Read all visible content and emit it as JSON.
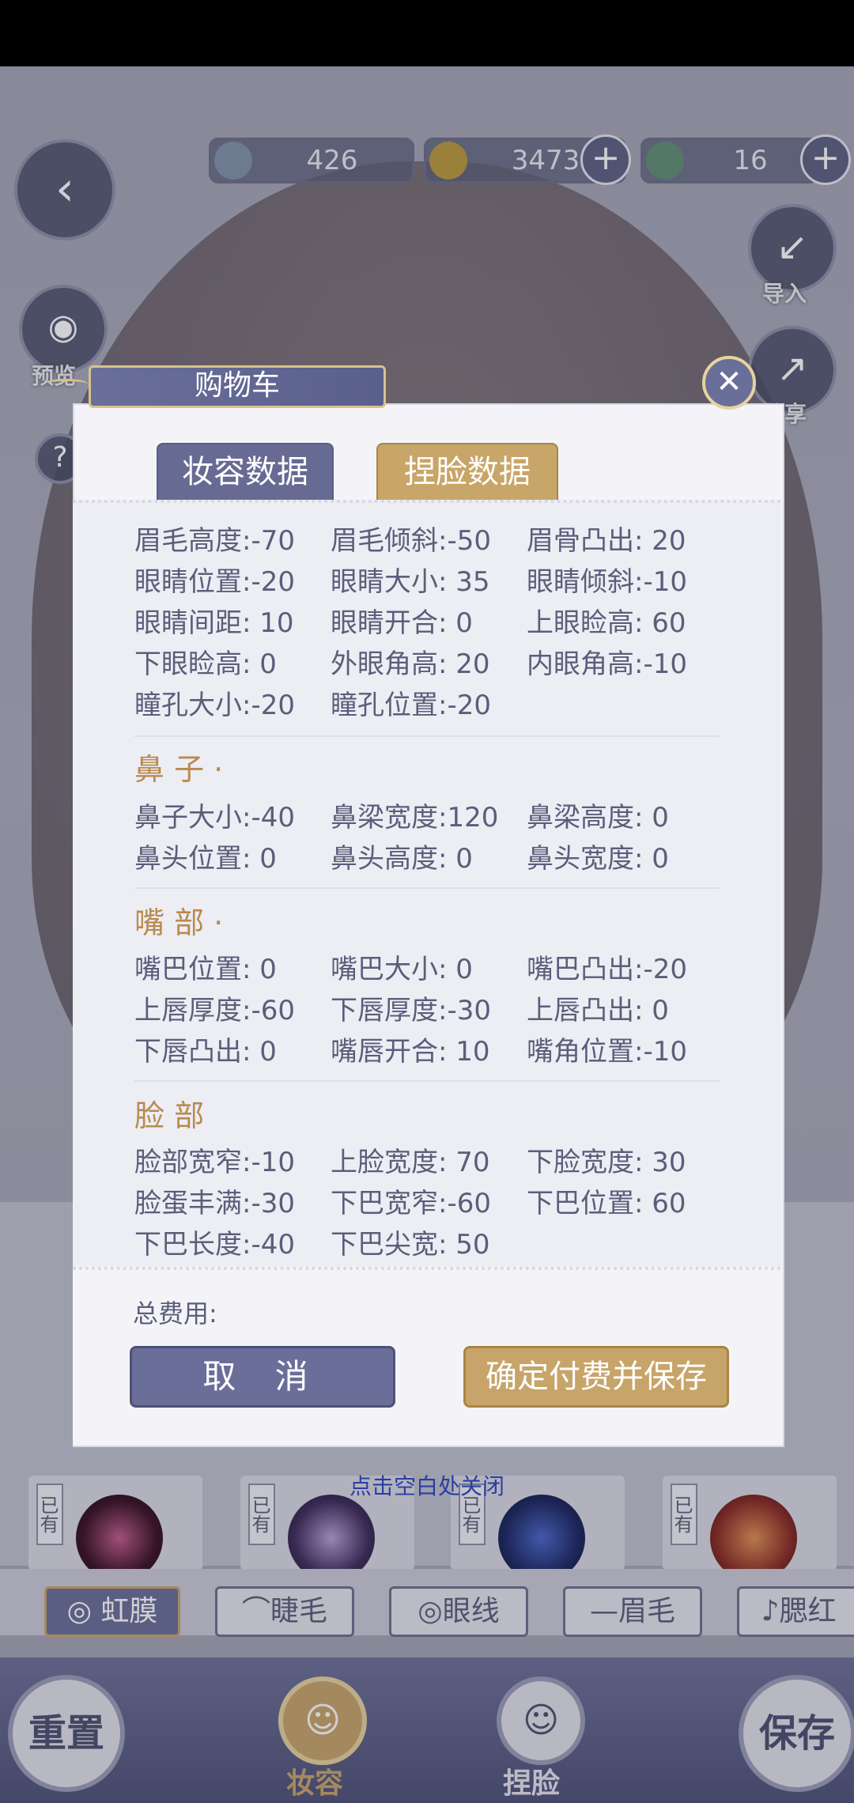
{
  "currency": {
    "coin1": "426",
    "coin2": "3473",
    "coin3": "16"
  },
  "side": {
    "preview_label": "预览",
    "import_label": "导入",
    "share_label": "分享",
    "help_label": "?"
  },
  "cart": {
    "title": "购物车",
    "tabs": [
      "妆容数据",
      "捏脸数据"
    ],
    "eye_rows": [
      [
        "眉毛高度:-70",
        "眉毛倾斜:-50",
        "眉骨凸出: 20"
      ],
      [
        "眼睛位置:-20",
        "眼睛大小: 35",
        "眼睛倾斜:-10"
      ],
      [
        "眼睛间距: 10",
        "眼睛开合:  0",
        "上眼睑高: 60"
      ],
      [
        "下眼睑高:  0",
        "外眼角高: 20",
        "内眼角高:-10"
      ],
      [
        "瞳孔大小:-20",
        "瞳孔位置:-20",
        ""
      ]
    ],
    "nose_title": "鼻 子 ·",
    "nose_rows": [
      [
        "鼻子大小:-40",
        "鼻梁宽度:120",
        "鼻梁高度:  0"
      ],
      [
        "鼻头位置:  0",
        "鼻头高度:  0",
        "鼻头宽度:  0"
      ]
    ],
    "mouth_title": "嘴 部 ·",
    "mouth_rows": [
      [
        "嘴巴位置:  0",
        "嘴巴大小:  0",
        "嘴巴凸出:-20"
      ],
      [
        "上唇厚度:-60",
        "下唇厚度:-30",
        "上唇凸出:  0"
      ],
      [
        "下唇凸出:  0",
        "嘴唇开合: 10",
        "嘴角位置:-10"
      ]
    ],
    "face_title": "脸 部",
    "face_rows": [
      [
        "脸部宽窄:-10",
        "上脸宽度: 70",
        "下脸宽度: 30"
      ],
      [
        "脸蛋丰满:-30",
        "下巴宽窄:-60",
        "下巴位置: 60"
      ],
      [
        "下巴长度:-40",
        "下巴尖宽: 50",
        ""
      ]
    ],
    "total_label": "总费用:",
    "cancel_label": "取 消",
    "confirm_label": "确定付费并保存",
    "close_hint": "点击空白处关闭"
  },
  "swatches": {
    "owned_label": "已有"
  },
  "categories": [
    "◎ 虹膜",
    "睫毛",
    "眼线",
    "眉毛",
    "腮红"
  ],
  "nav": {
    "reset_label": "重置",
    "makeup_label": "妆容",
    "face_label": "捏脸",
    "save_label": "保存"
  }
}
